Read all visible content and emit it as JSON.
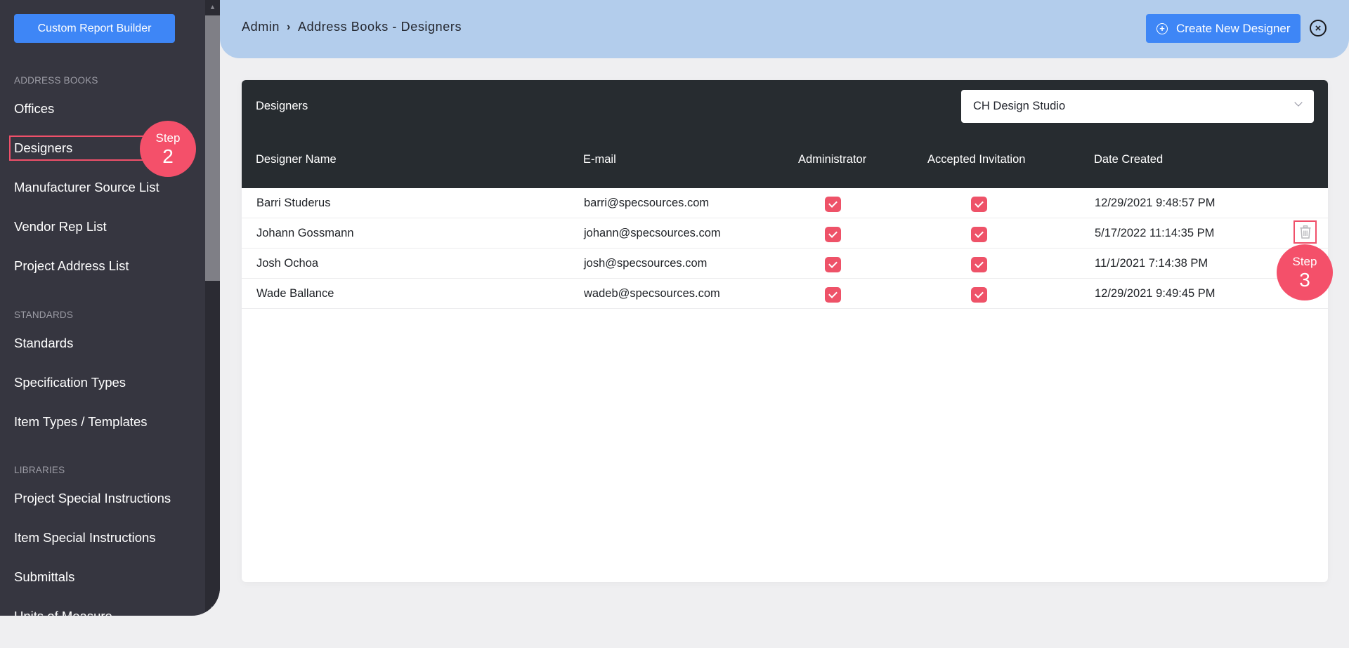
{
  "sidebar": {
    "report_button": "Custom Report Builder",
    "sections": [
      {
        "label": "ADDRESS BOOKS",
        "items": [
          "Offices",
          "Designers",
          "Manufacturer Source List",
          "Vendor Rep List",
          "Project Address List"
        ]
      },
      {
        "label": "STANDARDS",
        "items": [
          "Standards",
          "Specification Types",
          "Item Types / Templates"
        ]
      },
      {
        "label": "LIBRARIES",
        "items": [
          "Project Special Instructions",
          "Item Special Instructions",
          "Submittals",
          "Units of Measure"
        ]
      }
    ],
    "active_item": "Designers"
  },
  "steps": {
    "step2": {
      "word": "Step",
      "num": "2"
    },
    "step3": {
      "word": "Step",
      "num": "3"
    }
  },
  "header": {
    "breadcrumb": [
      "Admin",
      "Address Books - Designers"
    ],
    "breadcrumb_separator": "›",
    "create_button": "Create New Designer",
    "close_icon": "×"
  },
  "card": {
    "title": "Designers",
    "office_select": {
      "value": "CH Design Studio"
    },
    "columns": [
      "Designer Name",
      "E-mail",
      "Administrator",
      "Accepted Invitation",
      "Date Created"
    ],
    "rows": [
      {
        "name": "Barri Studerus",
        "email": "barri@specsources.com",
        "administrator": true,
        "accepted": true,
        "created": "12/29/2021 9:48:57 PM"
      },
      {
        "name": "Johann Gossmann",
        "email": "johann@specsources.com",
        "administrator": true,
        "accepted": true,
        "created": "5/17/2022 11:14:35 PM"
      },
      {
        "name": "Josh Ochoa",
        "email": "josh@specsources.com",
        "administrator": true,
        "accepted": true,
        "created": "11/1/2021 7:14:38 PM"
      },
      {
        "name": "Wade Ballance",
        "email": "wadeb@specsources.com",
        "administrator": true,
        "accepted": true,
        "created": "12/29/2021 9:49:45 PM"
      }
    ]
  },
  "colors": {
    "accent_blue": "#3e86f6",
    "header_bg": "#b3cdec",
    "sidebar_bg": "#363640",
    "table_head_bg": "#272c30",
    "check_red": "#ee5268",
    "step_badge": "#f4506a"
  }
}
